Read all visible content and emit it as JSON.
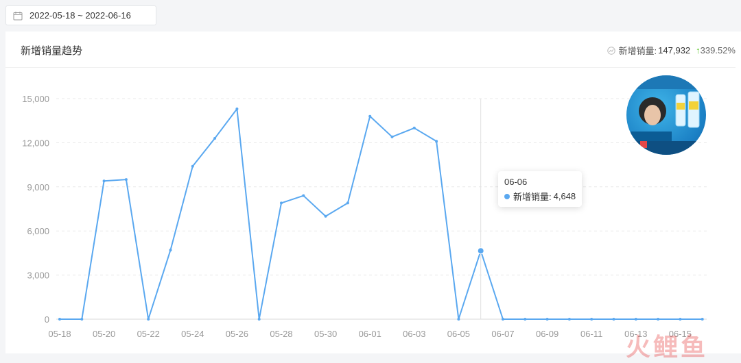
{
  "date_range": "2022-05-18 ~ 2022-06-16",
  "card": {
    "title": "新增销量趋势",
    "summary_label": "新增销量:",
    "summary_value": "147,932",
    "summary_change": "339.52%"
  },
  "tooltip": {
    "date": "06-06",
    "label": "新增销量:",
    "value": "4,648"
  },
  "watermark": "火鲤鱼",
  "colors": {
    "line": "#5aa8f0",
    "up": "#52c41a"
  },
  "chart_data": {
    "type": "line",
    "title": "新增销量趋势",
    "x": [
      "05-18",
      "05-19",
      "05-20",
      "05-21",
      "05-22",
      "05-23",
      "05-24",
      "05-25",
      "05-26",
      "05-27",
      "05-28",
      "05-29",
      "05-30",
      "05-31",
      "06-01",
      "06-02",
      "06-03",
      "06-04",
      "06-05",
      "06-06",
      "06-07",
      "06-08",
      "06-09",
      "06-10",
      "06-11",
      "06-12",
      "06-13",
      "06-14",
      "06-15",
      "06-16"
    ],
    "x_tick_labels": [
      "05-18",
      "05-20",
      "05-22",
      "05-24",
      "05-26",
      "05-28",
      "05-30",
      "06-01",
      "06-03",
      "06-05",
      "06-07",
      "06-09",
      "06-11",
      "06-13",
      "06-15"
    ],
    "series": [
      {
        "name": "新增销量",
        "values": [
          0,
          0,
          9400,
          9500,
          0,
          4700,
          10400,
          12300,
          14300,
          0,
          7900,
          8400,
          7000,
          7900,
          13800,
          12400,
          13000,
          12100,
          0,
          4648,
          0,
          0,
          0,
          0,
          0,
          0,
          0,
          0,
          0,
          0
        ]
      }
    ],
    "ylim": [
      0,
      15000
    ],
    "y_ticks": [
      0,
      3000,
      6000,
      9000,
      12000,
      15000
    ],
    "y_tick_labels": [
      "0",
      "3,000",
      "6,000",
      "9,000",
      "12,000",
      "15,000"
    ],
    "grid": true,
    "highlighted": "06-06"
  }
}
